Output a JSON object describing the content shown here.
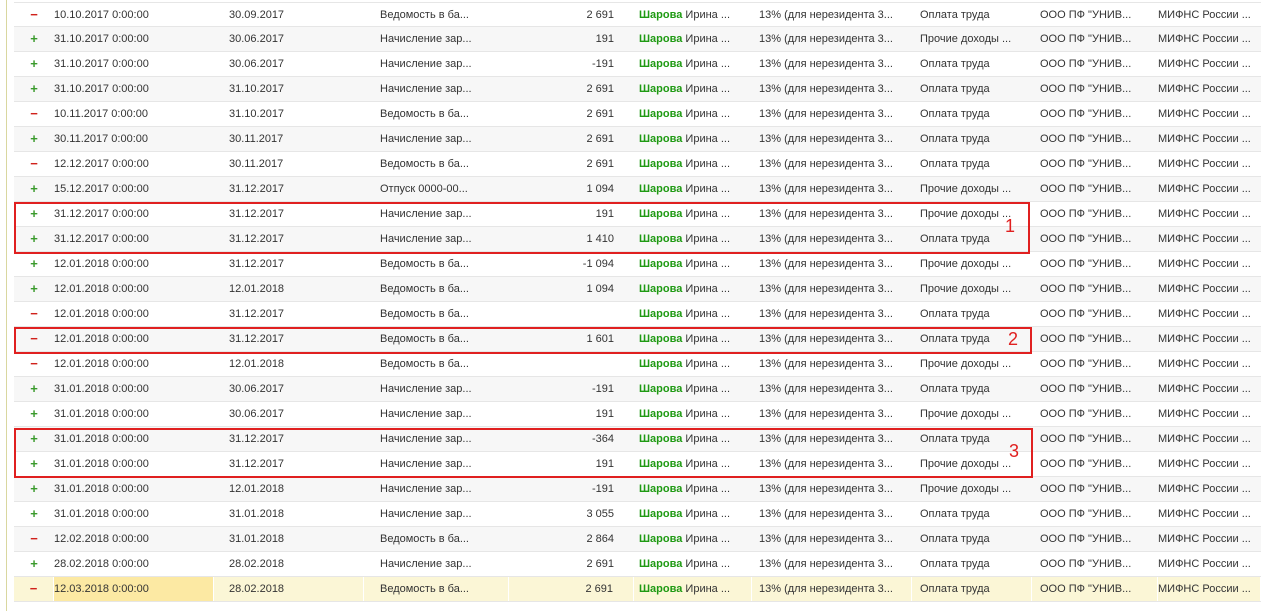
{
  "rows": [
    {
      "sign": "−",
      "type": "minus",
      "d1": "10.10.2017 0:00:00",
      "d2": "30.09.2017",
      "doc": "Ведомость в ба...",
      "sum": "2 691",
      "surname": "Шарова",
      "name": " Ирина ...",
      "rate": "13% (для нерезидента 3...",
      "inc": "Оплата труда",
      "org": "ООО ПФ \"УНИВ...",
      "ifns": "МИФНС России ..."
    },
    {
      "sign": "+",
      "type": "plus",
      "d1": "31.10.2017 0:00:00",
      "d2": "30.06.2017",
      "doc": "Начисление зар...",
      "sum": "191",
      "surname": "Шарова",
      "name": " Ирина ...",
      "rate": "13% (для нерезидента 3...",
      "inc": "Прочие доходы ...",
      "org": "ООО ПФ \"УНИВ...",
      "ifns": "МИФНС России ..."
    },
    {
      "sign": "+",
      "type": "plus",
      "d1": "31.10.2017 0:00:00",
      "d2": "30.06.2017",
      "doc": "Начисление зар...",
      "sum": "-191",
      "surname": "Шарова",
      "name": " Ирина ...",
      "rate": "13% (для нерезидента 3...",
      "inc": "Оплата труда",
      "org": "ООО ПФ \"УНИВ...",
      "ifns": "МИФНС России ..."
    },
    {
      "sign": "+",
      "type": "plus",
      "d1": "31.10.2017 0:00:00",
      "d2": "31.10.2017",
      "doc": "Начисление зар...",
      "sum": "2 691",
      "surname": "Шарова",
      "name": " Ирина ...",
      "rate": "13% (для нерезидента 3...",
      "inc": "Оплата труда",
      "org": "ООО ПФ \"УНИВ...",
      "ifns": "МИФНС России ..."
    },
    {
      "sign": "−",
      "type": "minus",
      "d1": "10.11.2017 0:00:00",
      "d2": "31.10.2017",
      "doc": "Ведомость в ба...",
      "sum": "2 691",
      "surname": "Шарова",
      "name": " Ирина ...",
      "rate": "13% (для нерезидента 3...",
      "inc": "Оплата труда",
      "org": "ООО ПФ \"УНИВ...",
      "ifns": "МИФНС России ..."
    },
    {
      "sign": "+",
      "type": "plus",
      "d1": "30.11.2017 0:00:00",
      "d2": "30.11.2017",
      "doc": "Начисление зар...",
      "sum": "2 691",
      "surname": "Шарова",
      "name": " Ирина ...",
      "rate": "13% (для нерезидента 3...",
      "inc": "Оплата труда",
      "org": "ООО ПФ \"УНИВ...",
      "ifns": "МИФНС России ..."
    },
    {
      "sign": "−",
      "type": "minus",
      "d1": "12.12.2017 0:00:00",
      "d2": "30.11.2017",
      "doc": "Ведомость в ба...",
      "sum": "2 691",
      "surname": "Шарова",
      "name": " Ирина ...",
      "rate": "13% (для нерезидента 3...",
      "inc": "Оплата труда",
      "org": "ООО ПФ \"УНИВ...",
      "ifns": "МИФНС России ..."
    },
    {
      "sign": "+",
      "type": "plus",
      "d1": "15.12.2017 0:00:00",
      "d2": "31.12.2017",
      "doc": "Отпуск 0000-00...",
      "sum": "1 094",
      "surname": "Шарова",
      "name": " Ирина ...",
      "rate": "13% (для нерезидента 3...",
      "inc": "Прочие доходы ...",
      "org": "ООО ПФ \"УНИВ...",
      "ifns": "МИФНС России ..."
    },
    {
      "sign": "+",
      "type": "plus",
      "d1": "31.12.2017 0:00:00",
      "d2": "31.12.2017",
      "doc": "Начисление зар...",
      "sum": "191",
      "surname": "Шарова",
      "name": " Ирина ...",
      "rate": "13% (для нерезидента 3...",
      "inc": "Прочие доходы ...",
      "org": "ООО ПФ \"УНИВ...",
      "ifns": "МИФНС России ..."
    },
    {
      "sign": "+",
      "type": "plus",
      "d1": "31.12.2017 0:00:00",
      "d2": "31.12.2017",
      "doc": "Начисление зар...",
      "sum": "1 410",
      "surname": "Шарова",
      "name": " Ирина ...",
      "rate": "13% (для нерезидента 3...",
      "inc": "Оплата труда",
      "org": "ООО ПФ \"УНИВ...",
      "ifns": "МИФНС России ..."
    },
    {
      "sign": "+",
      "type": "plus",
      "d1": "12.01.2018 0:00:00",
      "d2": "31.12.2017",
      "doc": "Ведомость в ба...",
      "sum": "-1 094",
      "surname": "Шарова",
      "name": " Ирина ...",
      "rate": "13% (для нерезидента 3...",
      "inc": "Прочие доходы ...",
      "org": "ООО ПФ \"УНИВ...",
      "ifns": "МИФНС России ..."
    },
    {
      "sign": "+",
      "type": "plus",
      "d1": "12.01.2018 0:00:00",
      "d2": "12.01.2018",
      "doc": "Ведомость в ба...",
      "sum": "1 094",
      "surname": "Шарова",
      "name": " Ирина ...",
      "rate": "13% (для нерезидента 3...",
      "inc": "Прочие доходы ...",
      "org": "ООО ПФ \"УНИВ...",
      "ifns": "МИФНС России ..."
    },
    {
      "sign": "−",
      "type": "minus",
      "d1": "12.01.2018 0:00:00",
      "d2": "31.12.2017",
      "doc": "Ведомость в ба...",
      "sum": "",
      "surname": "Шарова",
      "name": " Ирина ...",
      "rate": "13% (для нерезидента 3...",
      "inc": "Оплата труда",
      "org": "ООО ПФ \"УНИВ...",
      "ifns": "МИФНС России ..."
    },
    {
      "sign": "−",
      "type": "minus",
      "d1": "12.01.2018 0:00:00",
      "d2": "31.12.2017",
      "doc": "Ведомость в ба...",
      "sum": "1 601",
      "surname": "Шарова",
      "name": " Ирина ...",
      "rate": "13% (для нерезидента 3...",
      "inc": "Оплата труда",
      "org": "ООО ПФ \"УНИВ...",
      "ifns": "МИФНС России ..."
    },
    {
      "sign": "−",
      "type": "minus",
      "d1": "12.01.2018 0:00:00",
      "d2": "12.01.2018",
      "doc": "Ведомость в ба...",
      "sum": "",
      "surname": "Шарова",
      "name": " Ирина ...",
      "rate": "13% (для нерезидента 3...",
      "inc": "Прочие доходы ...",
      "org": "ООО ПФ \"УНИВ...",
      "ifns": "МИФНС России ..."
    },
    {
      "sign": "+",
      "type": "plus",
      "d1": "31.01.2018 0:00:00",
      "d2": "30.06.2017",
      "doc": "Начисление зар...",
      "sum": "-191",
      "surname": "Шарова",
      "name": " Ирина ...",
      "rate": "13% (для нерезидента 3...",
      "inc": "Оплата труда",
      "org": "ООО ПФ \"УНИВ...",
      "ifns": "МИФНС России ..."
    },
    {
      "sign": "+",
      "type": "plus",
      "d1": "31.01.2018 0:00:00",
      "d2": "30.06.2017",
      "doc": "Начисление зар...",
      "sum": "191",
      "surname": "Шарова",
      "name": " Ирина ...",
      "rate": "13% (для нерезидента 3...",
      "inc": "Прочие доходы ...",
      "org": "ООО ПФ \"УНИВ...",
      "ifns": "МИФНС России ..."
    },
    {
      "sign": "+",
      "type": "plus",
      "d1": "31.01.2018 0:00:00",
      "d2": "31.12.2017",
      "doc": "Начисление зар...",
      "sum": "-364",
      "surname": "Шарова",
      "name": " Ирина ...",
      "rate": "13% (для нерезидента 3...",
      "inc": "Оплата труда",
      "org": "ООО ПФ \"УНИВ...",
      "ifns": "МИФНС России ..."
    },
    {
      "sign": "+",
      "type": "plus",
      "d1": "31.01.2018 0:00:00",
      "d2": "31.12.2017",
      "doc": "Начисление зар...",
      "sum": "191",
      "surname": "Шарова",
      "name": " Ирина ...",
      "rate": "13% (для нерезидента 3...",
      "inc": "Прочие доходы ...",
      "org": "ООО ПФ \"УНИВ...",
      "ifns": "МИФНС России ..."
    },
    {
      "sign": "+",
      "type": "plus",
      "d1": "31.01.2018 0:00:00",
      "d2": "12.01.2018",
      "doc": "Начисление зар...",
      "sum": "-191",
      "surname": "Шарова",
      "name": " Ирина ...",
      "rate": "13% (для нерезидента 3...",
      "inc": "Прочие доходы ...",
      "org": "ООО ПФ \"УНИВ...",
      "ifns": "МИФНС России ..."
    },
    {
      "sign": "+",
      "type": "plus",
      "d1": "31.01.2018 0:00:00",
      "d2": "31.01.2018",
      "doc": "Начисление зар...",
      "sum": "3 055",
      "surname": "Шарова",
      "name": " Ирина ...",
      "rate": "13% (для нерезидента 3...",
      "inc": "Оплата труда",
      "org": "ООО ПФ \"УНИВ...",
      "ifns": "МИФНС России ..."
    },
    {
      "sign": "−",
      "type": "minus",
      "d1": "12.02.2018 0:00:00",
      "d2": "31.01.2018",
      "doc": "Ведомость в ба...",
      "sum": "2 864",
      "surname": "Шарова",
      "name": " Ирина ...",
      "rate": "13% (для нерезидента 3...",
      "inc": "Оплата труда",
      "org": "ООО ПФ \"УНИВ...",
      "ifns": "МИФНС России ..."
    },
    {
      "sign": "+",
      "type": "plus",
      "d1": "28.02.2018 0:00:00",
      "d2": "28.02.2018",
      "doc": "Начисление зар...",
      "sum": "2 691",
      "surname": "Шарова",
      "name": " Ирина ...",
      "rate": "13% (для нерезидента 3...",
      "inc": "Оплата труда",
      "org": "ООО ПФ \"УНИВ...",
      "ifns": "МИФНС России ..."
    },
    {
      "sign": "−",
      "type": "minus",
      "d1": "12.03.2018 0:00:00",
      "d2": "28.02.2018",
      "doc": "Ведомость в ба...",
      "sum": "2 691",
      "surname": "Шарова",
      "name": " Ирина ...",
      "rate": "13% (для нерезидента 3...",
      "inc": "Оплата труда",
      "org": "ООО ПФ \"УНИВ...",
      "ifns": "МИФНС России ..."
    }
  ],
  "annotations": {
    "label_1": "1",
    "label_2": "2",
    "label_3": "3",
    "color": "#e02020"
  },
  "colors": {
    "plus": "#3a9a2c",
    "minus": "#d0211b",
    "surname": "#1f9a13",
    "current_row": "#fbf6d6"
  }
}
